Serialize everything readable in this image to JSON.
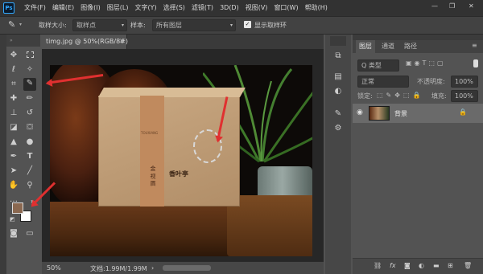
{
  "app": {
    "logo": "Ps"
  },
  "menu": [
    "文件(F)",
    "编辑(E)",
    "图像(I)",
    "图层(L)",
    "文字(Y)",
    "选择(S)",
    "滤镜(T)",
    "3D(D)",
    "视图(V)",
    "窗口(W)",
    "帮助(H)"
  ],
  "window_controls": {
    "minimize": "—",
    "restore": "❐",
    "close": "✕"
  },
  "options": {
    "sample_size_label": "取样大小:",
    "sample_size_value": "取样点",
    "sample_label": "样本:",
    "sample_value": "所有图层",
    "show_ring_label": "显示取样环",
    "show_ring_checked": true
  },
  "document": {
    "tab_title": "timg.jpg @ 50%(RGB/8#)",
    "close_glyph": "×"
  },
  "status": {
    "zoom": "50%",
    "doc_info": "文档:1.99M/1.99M"
  },
  "swatches": {
    "foreground": "#8a6850",
    "background": "#ffffff"
  },
  "product_box": {
    "brand": "TOUXIANG",
    "title": "金 视 眉",
    "stamp": "香叶亭"
  },
  "panel": {
    "tabs": [
      "图层",
      "通道",
      "路径"
    ],
    "filter_kind": "Q 类型",
    "blend_mode": "正常",
    "opacity_label": "不透明度:",
    "opacity_value": "100%",
    "lock_label": "锁定:",
    "fill_label": "填充:",
    "fill_value": "100%",
    "layer_name": "背景"
  },
  "colors": {
    "accent": "#31a8ff",
    "arrow": "#e03030"
  }
}
